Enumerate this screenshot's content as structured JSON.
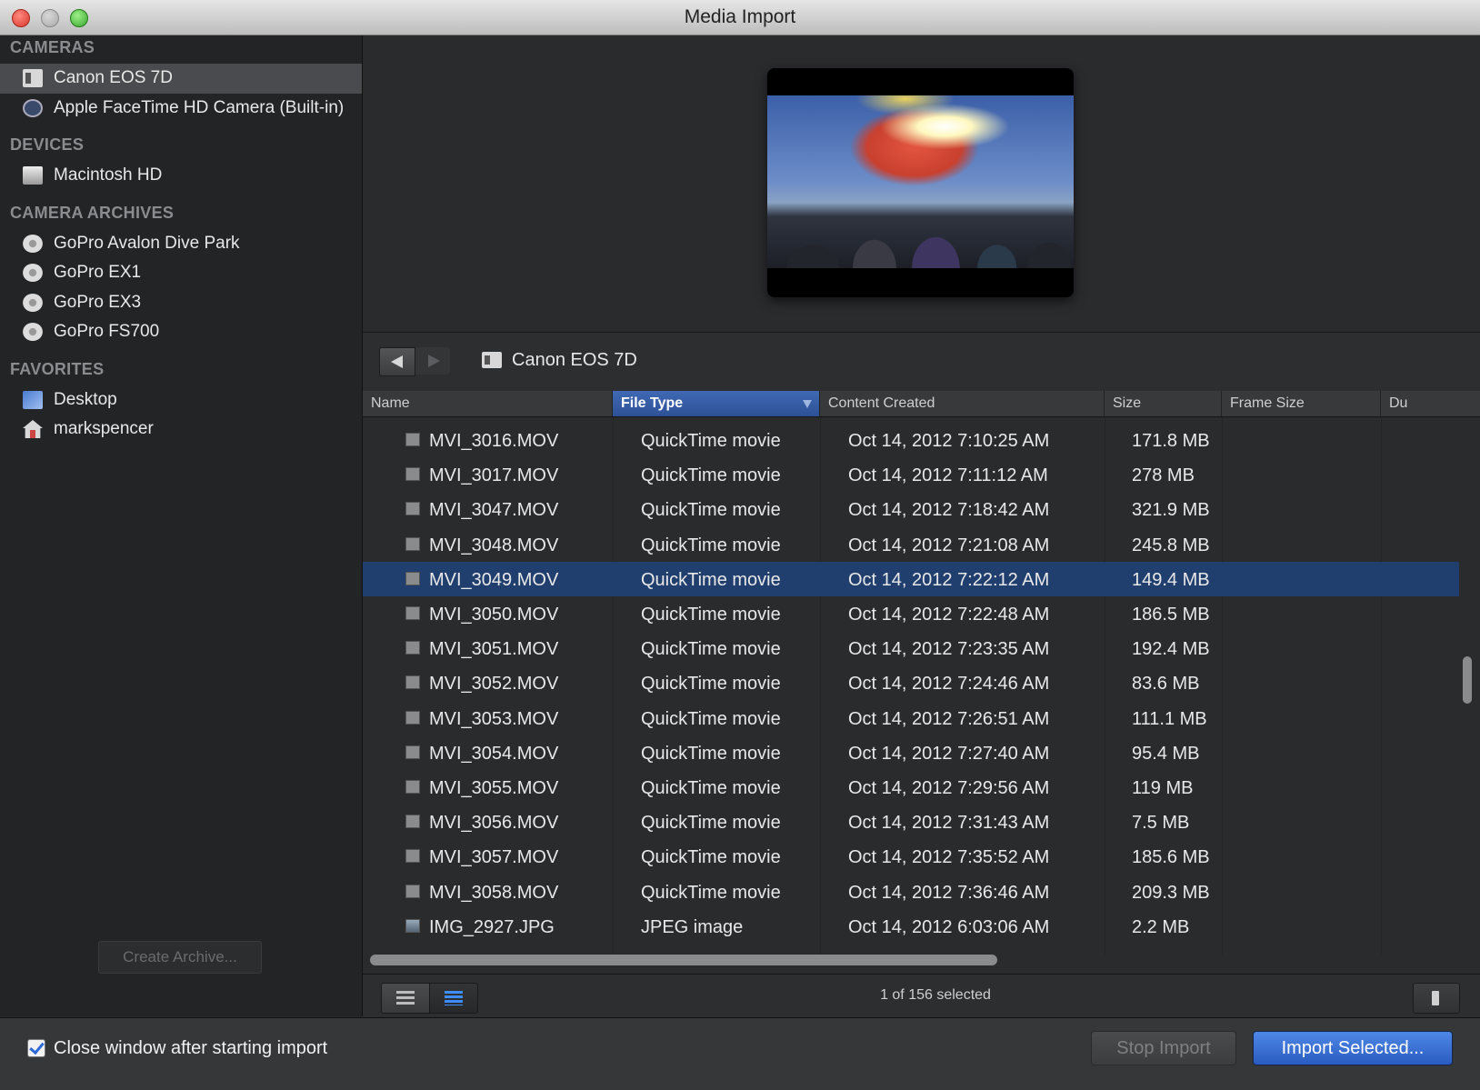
{
  "window": {
    "title": "Media Import"
  },
  "sidebar": {
    "sections": [
      {
        "header": "CAMERAS",
        "items": [
          {
            "label": "Canon EOS 7D",
            "icon": "camera-icon",
            "selected": true
          },
          {
            "label": "Apple FaceTime HD Camera (Built-in)",
            "icon": "facetime-camera-icon",
            "selected": false
          }
        ]
      },
      {
        "header": "DEVICES",
        "items": [
          {
            "label": "Macintosh HD",
            "icon": "hard-disk-icon",
            "selected": false
          }
        ]
      },
      {
        "header": "CAMERA ARCHIVES",
        "items": [
          {
            "label": "GoPro Avalon Dive Park",
            "icon": "archive-icon",
            "selected": false
          },
          {
            "label": "GoPro EX1",
            "icon": "archive-icon",
            "selected": false
          },
          {
            "label": "GoPro EX3",
            "icon": "archive-icon",
            "selected": false
          },
          {
            "label": "GoPro FS700",
            "icon": "archive-icon",
            "selected": false
          }
        ]
      },
      {
        "header": "FAVORITES",
        "items": [
          {
            "label": "Desktop",
            "icon": "desktop-icon",
            "selected": false
          },
          {
            "label": "markspencer",
            "icon": "home-folder-icon",
            "selected": false
          }
        ]
      }
    ],
    "create_archive_label": "Create Archive..."
  },
  "pathbar": {
    "current": "Canon EOS 7D"
  },
  "table": {
    "columns": [
      "Name",
      "File Type",
      "Content Created",
      "Size",
      "Frame Size",
      "Du"
    ],
    "sorted_column": "File Type",
    "rows": [
      {
        "name": "MVI_3016.MOV",
        "type": "QuickTime movie",
        "created": "Oct 14, 2012 7:10:25 AM",
        "size": "171.8 MB",
        "selected": false,
        "kind": "movie"
      },
      {
        "name": "MVI_3017.MOV",
        "type": "QuickTime movie",
        "created": "Oct 14, 2012 7:11:12 AM",
        "size": "278 MB",
        "selected": false,
        "kind": "movie"
      },
      {
        "name": "MVI_3047.MOV",
        "type": "QuickTime movie",
        "created": "Oct 14, 2012 7:18:42 AM",
        "size": "321.9 MB",
        "selected": false,
        "kind": "movie"
      },
      {
        "name": "MVI_3048.MOV",
        "type": "QuickTime movie",
        "created": "Oct 14, 2012 7:21:08 AM",
        "size": "245.8 MB",
        "selected": false,
        "kind": "movie"
      },
      {
        "name": "MVI_3049.MOV",
        "type": "QuickTime movie",
        "created": "Oct 14, 2012 7:22:12 AM",
        "size": "149.4 MB",
        "selected": true,
        "kind": "movie"
      },
      {
        "name": "MVI_3050.MOV",
        "type": "QuickTime movie",
        "created": "Oct 14, 2012 7:22:48 AM",
        "size": "186.5 MB",
        "selected": false,
        "kind": "movie"
      },
      {
        "name": "MVI_3051.MOV",
        "type": "QuickTime movie",
        "created": "Oct 14, 2012 7:23:35 AM",
        "size": "192.4 MB",
        "selected": false,
        "kind": "movie"
      },
      {
        "name": "MVI_3052.MOV",
        "type": "QuickTime movie",
        "created": "Oct 14, 2012 7:24:46 AM",
        "size": "83.6 MB",
        "selected": false,
        "kind": "movie"
      },
      {
        "name": "MVI_3053.MOV",
        "type": "QuickTime movie",
        "created": "Oct 14, 2012 7:26:51 AM",
        "size": "111.1 MB",
        "selected": false,
        "kind": "movie"
      },
      {
        "name": "MVI_3054.MOV",
        "type": "QuickTime movie",
        "created": "Oct 14, 2012 7:27:40 AM",
        "size": "95.4 MB",
        "selected": false,
        "kind": "movie"
      },
      {
        "name": "MVI_3055.MOV",
        "type": "QuickTime movie",
        "created": "Oct 14, 2012 7:29:56 AM",
        "size": "119 MB",
        "selected": false,
        "kind": "movie"
      },
      {
        "name": "MVI_3056.MOV",
        "type": "QuickTime movie",
        "created": "Oct 14, 2012 7:31:43 AM",
        "size": "7.5 MB",
        "selected": false,
        "kind": "movie"
      },
      {
        "name": "MVI_3057.MOV",
        "type": "QuickTime movie",
        "created": "Oct 14, 2012 7:35:52 AM",
        "size": "185.6 MB",
        "selected": false,
        "kind": "movie"
      },
      {
        "name": "MVI_3058.MOV",
        "type": "QuickTime movie",
        "created": "Oct 14, 2012 7:36:46 AM",
        "size": "209.3 MB",
        "selected": false,
        "kind": "movie"
      },
      {
        "name": "IMG_2927.JPG",
        "type": "JPEG image",
        "created": "Oct 14, 2012 6:03:06 AM",
        "size": "2.2 MB",
        "selected": false,
        "kind": "image"
      }
    ]
  },
  "status": {
    "selection": "1 of 156 selected"
  },
  "footer": {
    "close_window_label": "Close window after starting import",
    "close_window_checked": true,
    "stop_import_label": "Stop Import",
    "import_selected_label": "Import Selected..."
  },
  "colors": {
    "accent": "#2c68d8",
    "selected_row": "#213f6e",
    "sidebar_bg": "#232426"
  }
}
